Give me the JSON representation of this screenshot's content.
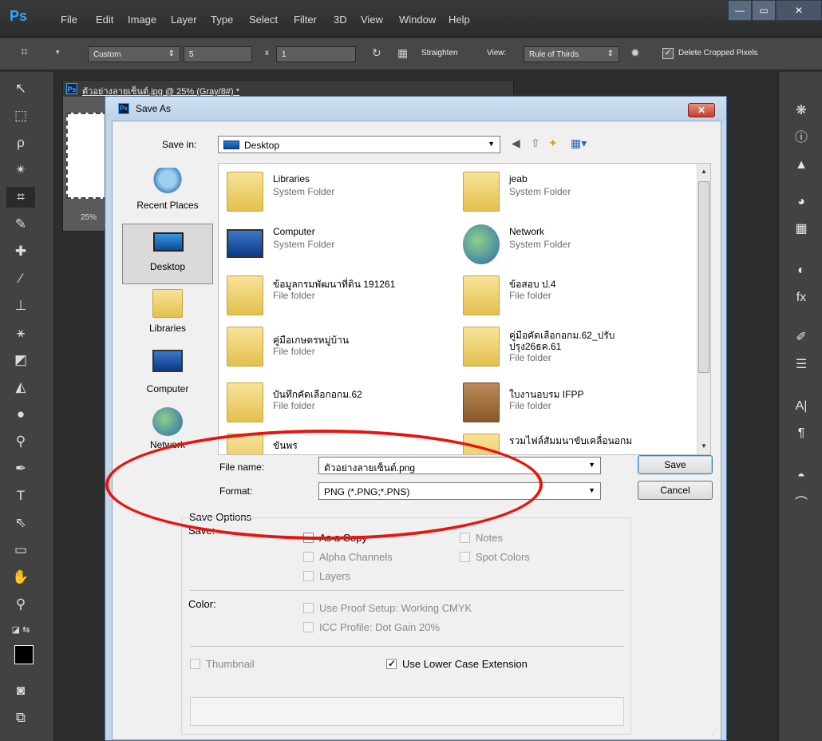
{
  "app": {
    "logo": "Ps"
  },
  "menu": [
    "File",
    "Edit",
    "Image",
    "Layer",
    "Type",
    "Select",
    "Filter",
    "3D",
    "View",
    "Window",
    "Help"
  ],
  "window_controls": {
    "minimize": "—",
    "maximize": "▭",
    "close": "✕"
  },
  "options_bar": {
    "preset": "Custom",
    "width": "5",
    "times": "x",
    "height": "1",
    "straighten": "Straighten",
    "view_label": "View:",
    "view_value": "Rule of Thirds",
    "delete_cropped": "Delete Cropped Pixels"
  },
  "document": {
    "logo": "Ps",
    "title": "ตัวอย่างลายเซ็นต์.jpg @ 25% (Gray/8#) *",
    "zoom": "25%"
  },
  "dialog": {
    "title": "Save As",
    "close": "✕",
    "save_in_label": "Save in:",
    "save_in_value": "Desktop",
    "places": [
      {
        "label": "Recent Places",
        "icon": "recent-places-icon"
      },
      {
        "label": "Desktop",
        "icon": "desktop-icon",
        "selected": true
      },
      {
        "label": "Libraries",
        "icon": "libraries-icon"
      },
      {
        "label": "Computer",
        "icon": "computer-icon"
      },
      {
        "label": "Network",
        "icon": "network-icon"
      }
    ],
    "files": [
      {
        "name": "Libraries",
        "type": "System Folder",
        "icon": "libraries-folder-icon"
      },
      {
        "name": "jeab",
        "type": "System Folder",
        "icon": "user-folder-icon"
      },
      {
        "name": "Computer",
        "type": "System Folder",
        "icon": "computer-icon"
      },
      {
        "name": "Network",
        "type": "System Folder",
        "icon": "network-icon"
      },
      {
        "name": "ข้อมูลกรมพัฒนาที่ดิน 191261",
        "type": "File folder",
        "icon": "folder-icon"
      },
      {
        "name": "ข้อสอบ ป.4",
        "type": "File folder",
        "icon": "folder-icon"
      },
      {
        "name": "คู่มือเกษตรหมู่บ้าน",
        "type": "File folder",
        "icon": "folder-icon"
      },
      {
        "name": "คู่มือคัดเลือกอกม.62_ปรับ",
        "name2": "ปรุง26ธค.61",
        "type": "File folder",
        "icon": "folder-icon"
      },
      {
        "name": "บันทึกคัดเลือกอกม.62",
        "type": "File folder",
        "icon": "folder-icon"
      },
      {
        "name": "ใบงานอบรม IFPP",
        "type": "File folder",
        "icon": "folder-icon"
      },
      {
        "name": "ขันพร",
        "type": "",
        "icon": "folder-icon"
      },
      {
        "name": "รวมไฟล์สัมมนาขับเคลื่อนอกม",
        "type": "",
        "icon": "folder-icon"
      }
    ],
    "file_name_label": "File name:",
    "file_name_value": "ตัวอย่างลายเซ็นต์.png",
    "format_label": "Format:",
    "format_value": "PNG (*.PNG;*.PNS)",
    "save_button": "Save",
    "cancel_button": "Cancel",
    "save_options": {
      "title": "Save Options",
      "save_label": "Save:",
      "as_a_copy": "As a Copy",
      "notes": "Notes",
      "alpha_channels": "Alpha Channels",
      "spot_colors": "Spot Colors",
      "layers": "Layers",
      "color_label": "Color:",
      "use_proof_setup": "Use Proof Setup:  Working CMYK",
      "icc_profile": "ICC Profile:  Dot Gain 20%",
      "thumbnail": "Thumbnail",
      "use_lower_case": "Use Lower Case Extension",
      "use_lower_case_checked": true
    }
  },
  "colors": {
    "annotation": "#e8150f",
    "ps_blue": "#31a8ff"
  }
}
